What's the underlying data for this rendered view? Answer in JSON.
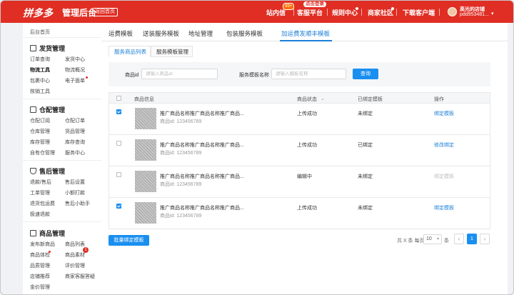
{
  "topbar": {
    "logo": "拼多多",
    "logo_sub": "管理后台",
    "back_label": "返回首页",
    "nav": [
      {
        "label": "站内信",
        "badge": "99+"
      },
      {
        "label": "客服平台",
        "tooltip": "点击登录"
      },
      {
        "label": "规则中心",
        "dot": true
      },
      {
        "label": "商家社区",
        "dot": true
      },
      {
        "label": "下载客户端"
      }
    ],
    "store_name": "高光的店铺",
    "store_id": "pdd953481..."
  },
  "sidebar": {
    "home": "后台首页",
    "groups": [
      {
        "title": "发货管理",
        "icon": "document-icon",
        "items": [
          "订单查询",
          "发货中心",
          "物流工具",
          "物流概况",
          "包裹中心",
          "电子面单",
          "核销工具"
        ],
        "active": "物流工具",
        "dot_item": "电子面单"
      },
      {
        "title": "仓配管理",
        "icon": "box-icon",
        "items": [
          "仓配订阅",
          "仓配订单",
          "仓库管理",
          "货品管理",
          "库存管理",
          "库存查询",
          "自有仓管理",
          "服务中心"
        ]
      },
      {
        "title": "售后管理",
        "icon": "shield-icon",
        "items": [
          "退款/售后",
          "售后设置",
          "工单管理",
          "小额打款",
          "退货包运费",
          "售后小助手",
          "极速退款"
        ]
      },
      {
        "title": "商品管理",
        "icon": "bag-icon",
        "items": [
          "发布新商品",
          "商品列表",
          "商品体检",
          "商品素材",
          "品质管理",
          "评价管理",
          "店铺推荐",
          "商家客服答疑",
          "金价管理"
        ],
        "badge_item": "商品素材",
        "badge": "1",
        "dot_item": "商品体检"
      }
    ]
  },
  "tabs": [
    "运费模板",
    "送装服务模板",
    "地址管理",
    "包装服务模板",
    "加运费发顺丰模板"
  ],
  "active_tab": "加运费发顺丰模板",
  "subtabs": [
    "服务商品列表",
    "服务模板管理"
  ],
  "filter": {
    "product_id_label": "商品id",
    "product_id_placeholder": "请输入商品id",
    "template_label": "服务模板名称",
    "template_placeholder": "请输入模板名称",
    "search_label": "查询"
  },
  "table": {
    "headers": [
      "商品信息",
      "商品状态",
      "已绑定模板",
      "操作"
    ],
    "rows": [
      {
        "checked": true,
        "name": "推广商品名称推广商品名称推广商品...",
        "id": "商品id: 123456789",
        "status": "上传成功",
        "template": "未绑定",
        "action": "绑定模板",
        "action_enabled": true
      },
      {
        "checked": false,
        "name": "推广商品名称推广商品名称推广商品...",
        "id": "商品id: 123456789",
        "status": "上传成功",
        "template": "已绑定",
        "action": "修改绑定",
        "action_enabled": true
      },
      {
        "checked": false,
        "name": "推广商品名称推广商品名称推广商品...",
        "id": "商品id: 123456789",
        "status": "编辑中",
        "template": "未绑定",
        "action": "绑定模板",
        "action_enabled": false
      },
      {
        "checked": true,
        "name": "推广商品名称推广商品名称推广商品...",
        "id": "商品id: 123456789",
        "status": "上传成功",
        "template": "未绑定",
        "action": "绑定模板",
        "action_enabled": true
      }
    ]
  },
  "footer": {
    "batch_label": "批量绑定模板",
    "total_text": "共 X 条  每页",
    "page_size": "10",
    "per_unit": "条",
    "current_page": "1"
  },
  "colors": {
    "brand_red": "#e02e24",
    "accent_blue": "#1a8ff0"
  }
}
